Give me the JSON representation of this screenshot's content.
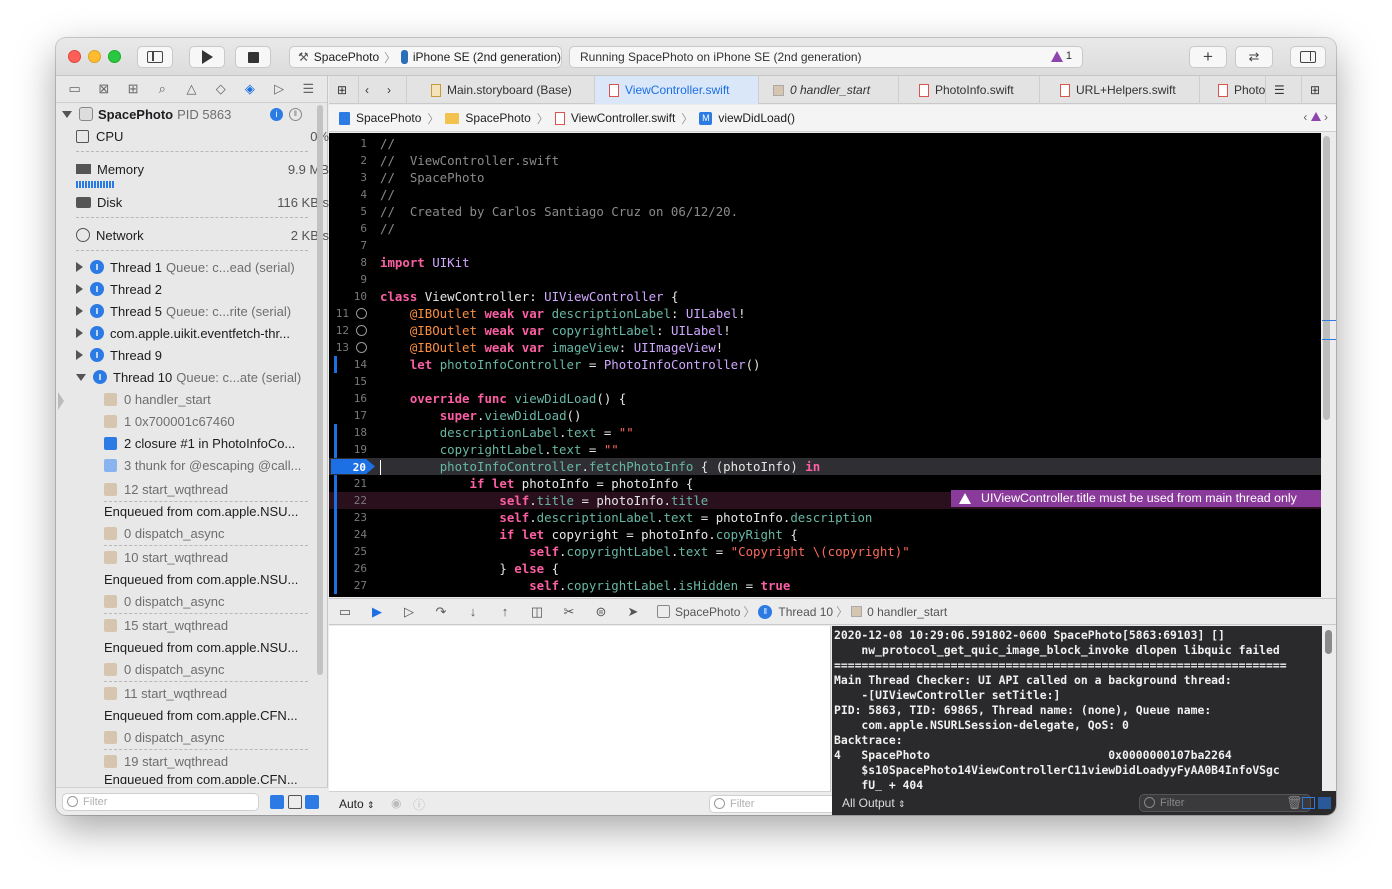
{
  "toolbar": {
    "scheme": "SpacePhoto",
    "device": "iPhone SE (2nd generation)",
    "status": "Running SpacePhoto on iPhone SE (2nd generation)",
    "warnings": "1",
    "add_symbol": "+"
  },
  "navigator": {
    "process_name": "SpacePhoto",
    "process_pid": "PID 5863",
    "gauges": [
      {
        "label": "CPU",
        "value": "0%"
      },
      {
        "label": "Memory",
        "value": "9.9 MB"
      },
      {
        "label": "Disk",
        "value": "116 KB/s"
      },
      {
        "label": "Network",
        "value": "2 KB/s"
      }
    ],
    "threads": [
      {
        "name": "Thread 1",
        "queue": "Queue: c...ead (serial)"
      },
      {
        "name": "Thread 2",
        "queue": ""
      },
      {
        "name": "Thread 5",
        "queue": "Queue: c...rite (serial)"
      },
      {
        "name": "com.apple.uikit.eventfetch-thr...",
        "queue": ""
      },
      {
        "name": "Thread 9",
        "queue": ""
      },
      {
        "name": "Thread 10",
        "queue": "Queue: c...ate (serial)"
      }
    ],
    "frames": [
      "0 handler_start",
      "1 0x700001c67460",
      "2 closure #1 in PhotoInfoCo...",
      "3 thunk for @escaping @call...",
      "12 start_wqthread",
      "Enqueued from com.apple.NSU...",
      "0 dispatch_async",
      "10 start_wqthread",
      "Enqueued from com.apple.NSU...",
      "0 dispatch_async",
      "15 start_wqthread",
      "Enqueued from com.apple.NSU...",
      "0 dispatch_async",
      "11 start_wqthread",
      "Enqueued from com.apple.CFN...",
      "0 dispatch_async",
      "19 start_wqthread",
      "Enqueued from com.apple.CFN..."
    ],
    "filter_placeholder": "Filter"
  },
  "tabs": [
    {
      "label": "Main.storyboard (Base)"
    },
    {
      "label": "ViewController.swift"
    },
    {
      "label": "0 handler_start"
    },
    {
      "label": "PhotoInfo.swift"
    },
    {
      "label": "URL+Helpers.swift"
    },
    {
      "label": "Photo"
    }
  ],
  "jumpbar": [
    "SpacePhoto",
    "SpacePhoto",
    "ViewController.swift",
    "viewDidLoad()"
  ],
  "code_lines": [
    {
      "n": "1",
      "t": "//"
    },
    {
      "n": "2",
      "t": "//  ViewController.swift"
    },
    {
      "n": "3",
      "t": "//  SpacePhoto"
    },
    {
      "n": "4",
      "t": "//"
    },
    {
      "n": "5",
      "t": "//  Created by Carlos Santiago Cruz on 06/12/20."
    },
    {
      "n": "6",
      "t": "//"
    },
    {
      "n": "7",
      "t": ""
    },
    {
      "n": "8",
      "t": "import UIKit"
    },
    {
      "n": "9",
      "t": ""
    },
    {
      "n": "10",
      "t": "class ViewController: UIViewController {"
    },
    {
      "n": "11",
      "t": "    @IBOutlet weak var descriptionLabel: UILabel!"
    },
    {
      "n": "12",
      "t": "    @IBOutlet weak var copyrightLabel: UILabel!"
    },
    {
      "n": "13",
      "t": "    @IBOutlet weak var imageView: UIImageView!"
    },
    {
      "n": "14",
      "t": "    let photoInfoController = PhotoInfoController()"
    },
    {
      "n": "15",
      "t": ""
    },
    {
      "n": "16",
      "t": "    override func viewDidLoad() {"
    },
    {
      "n": "17",
      "t": "        super.viewDidLoad()"
    },
    {
      "n": "18",
      "t": "        descriptionLabel.text = \"\""
    },
    {
      "n": "19",
      "t": "        copyrightLabel.text = \"\""
    },
    {
      "n": "20",
      "t": "        photoInfoController.fetchPhotoInfo { (photoInfo) in"
    },
    {
      "n": "21",
      "t": "            if let photoInfo = photoInfo {"
    },
    {
      "n": "22",
      "t": "                self.title = photoInfo.title"
    },
    {
      "n": "23",
      "t": "                self.descriptionLabel.text = photoInfo.description"
    },
    {
      "n": "24",
      "t": "                if let copyright = photoInfo.copyRight {"
    },
    {
      "n": "25",
      "t": "                    self.copyrightLabel.text = \"Copyright \\(copyright)\""
    },
    {
      "n": "26",
      "t": "                } else {"
    },
    {
      "n": "27",
      "t": "                    self.copyrightLabel.isHidden = true"
    }
  ],
  "warning_message": "UIViewController.title must be used from main thread only",
  "debug_bar": {
    "app": "SpacePhoto",
    "thread": "Thread 10",
    "frame": "0 handler_start"
  },
  "console_lines": [
    "2020-12-08 10:29:06.591802-0600 SpacePhoto[5863:69103] []",
    "    nw_protocol_get_quic_image_block_invoke dlopen libquic failed",
    "==================================================================",
    "Main Thread Checker: UI API called on a background thread:",
    "    -[UIViewController setTitle:]",
    "PID: 5863, TID: 69865, Thread name: (none), Queue name:",
    "    com.apple.NSURLSession-delegate, QoS: 0",
    "Backtrace:",
    "4   SpacePhoto                          0x0000000107ba2264",
    "    $s10SpacePhoto14ViewControllerC11viewDidLoadyyFyAA0B4InfoVSgc",
    "    fU_ + 404"
  ],
  "bottom": {
    "auto_label": "Auto",
    "filter_placeholder": "Filter",
    "output_label": "All Output",
    "console_filter_placeholder": "Filter"
  },
  "colors": {
    "accent": "#1d6fe4",
    "warning": "#8a3a9a",
    "editor_bg": "#000000",
    "console_bg": "#2a2a2c"
  }
}
